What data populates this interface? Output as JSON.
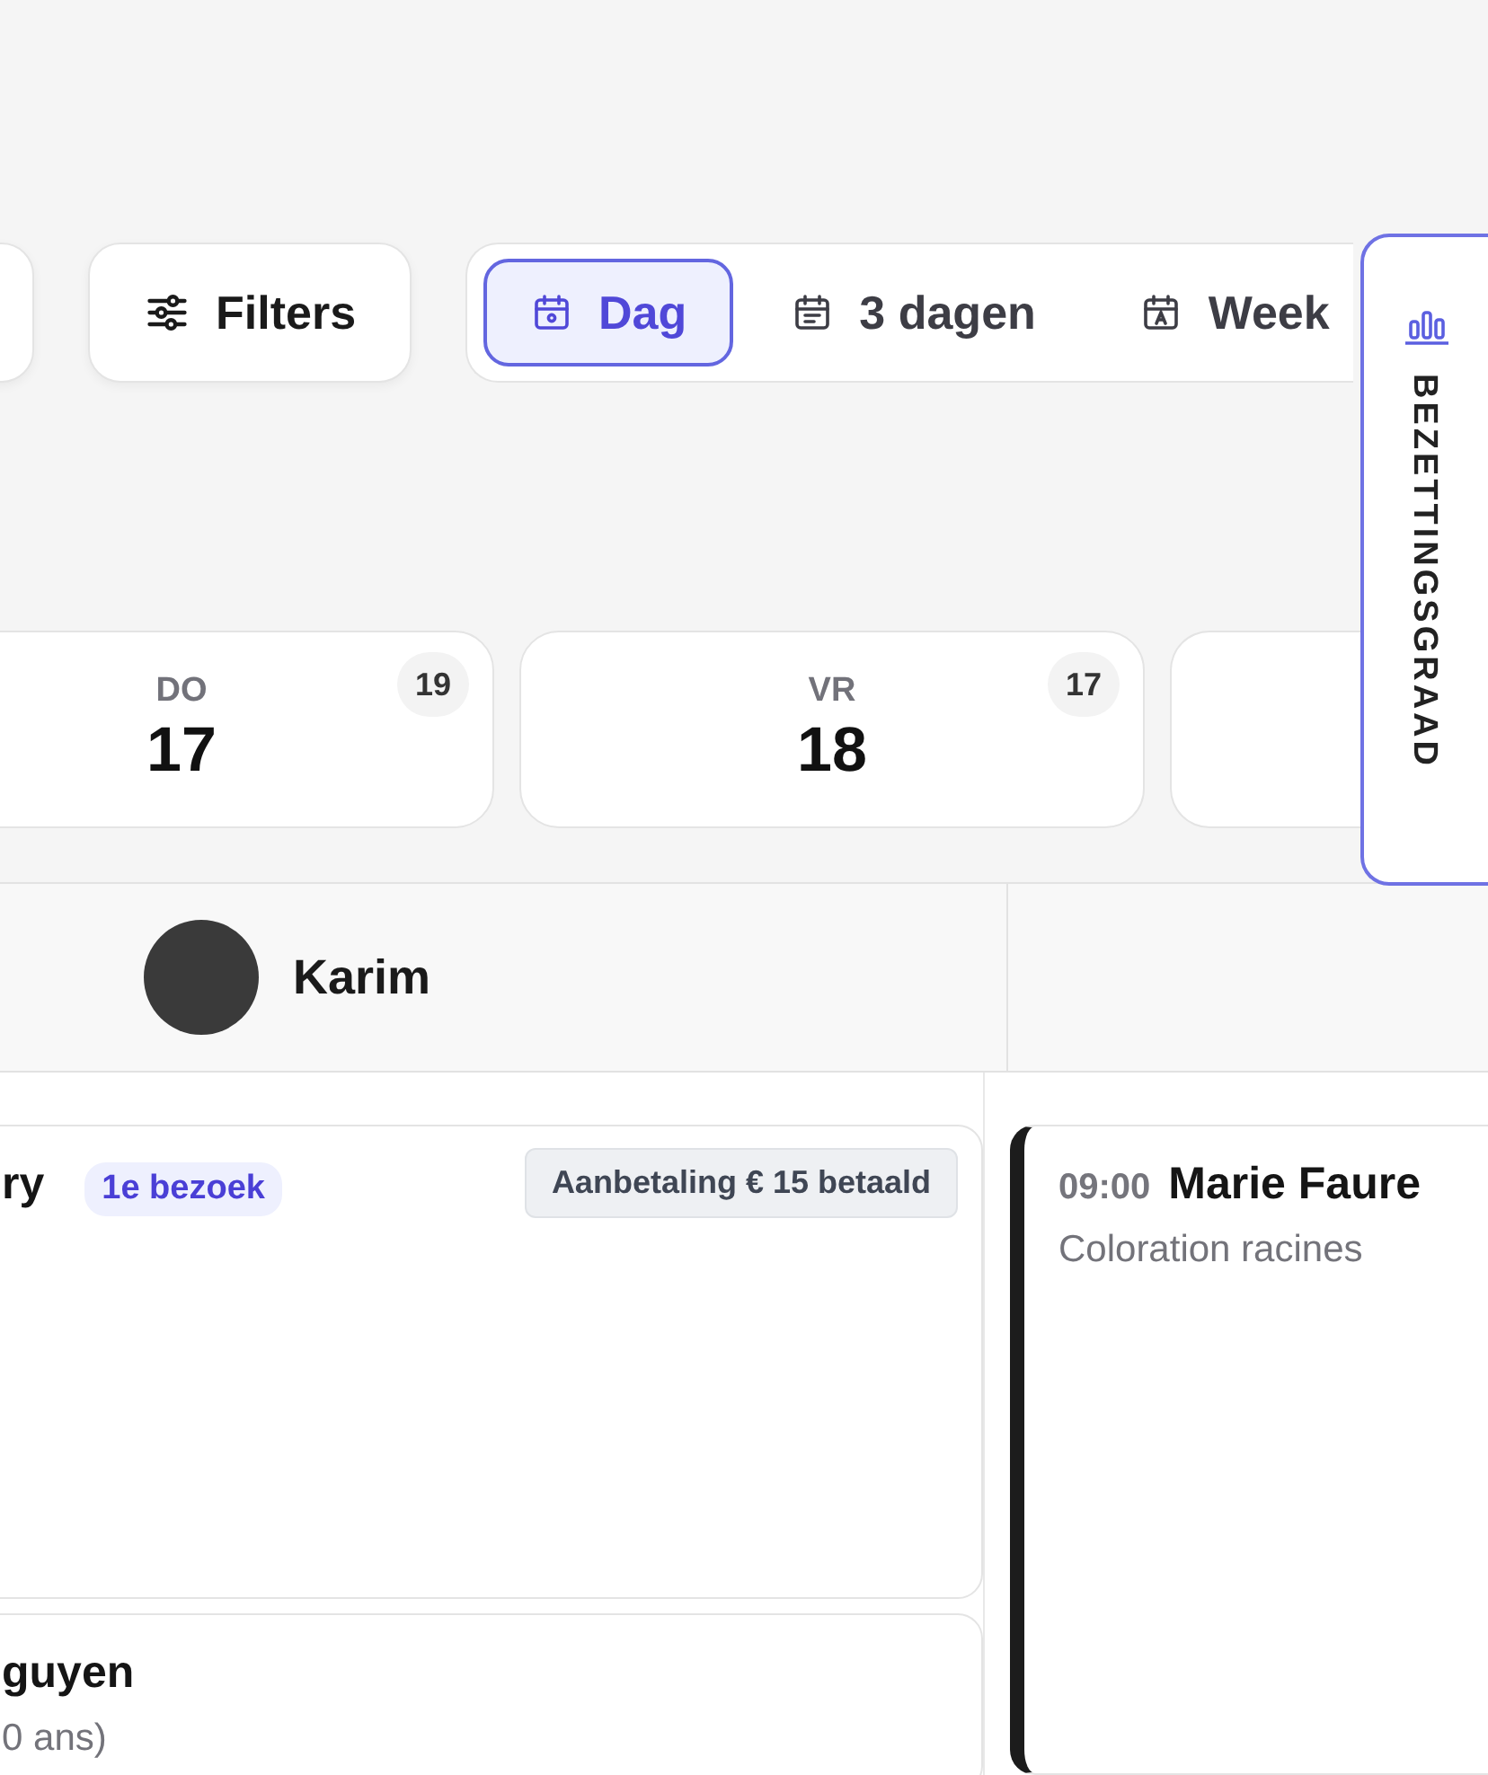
{
  "toolbar": {
    "filters": {
      "label": "Filters"
    },
    "views": [
      {
        "label": "Dag",
        "selected": true,
        "kind": "day"
      },
      {
        "label": "3 dagen",
        "selected": false,
        "kind": "three"
      },
      {
        "label": "Week",
        "selected": false,
        "kind": "week"
      }
    ]
  },
  "side_tab": {
    "label": "BEZETTINGSGRAAD"
  },
  "days": [
    {
      "weekday": "DO",
      "date": "17",
      "count": "19"
    },
    {
      "weekday": "VR",
      "date": "18",
      "count": "17"
    }
  ],
  "staff": [
    {
      "name": "Karim"
    }
  ],
  "appointments": [
    {
      "cards": [
        {
          "name": "ry",
          "tag": "1e bezoek",
          "badge": "Aanbetaling € 15 betaald",
          "tall": true
        },
        {
          "name": "guyen",
          "detail": "0 ans)",
          "tall": false
        }
      ]
    },
    {
      "cards": [
        {
          "time": "09:00",
          "name": "Marie Faure",
          "detail": "Coloration racines",
          "color": "#1c1c1c",
          "tall": true
        }
      ]
    }
  ]
}
